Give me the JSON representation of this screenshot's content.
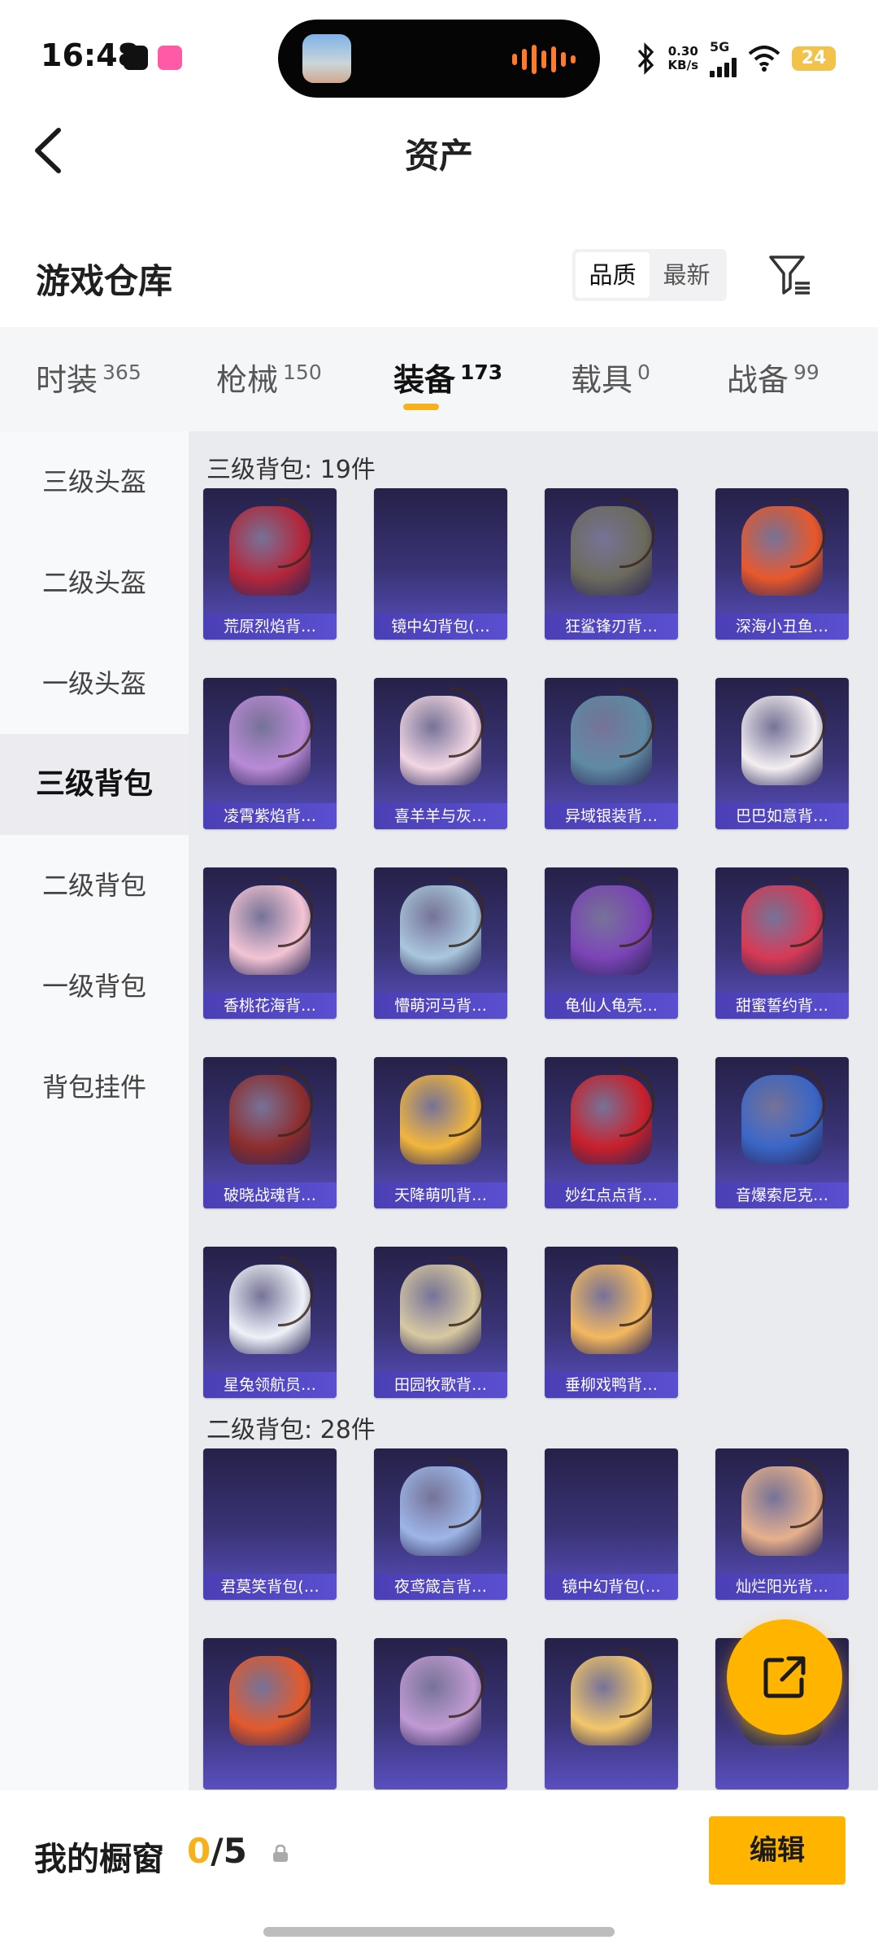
{
  "status": {
    "time": "16:48",
    "speed_value": "0.30",
    "speed_unit": "KB/s",
    "network": "5G",
    "battery": "24"
  },
  "header": {
    "title": "资产"
  },
  "section": {
    "title": "游戏仓库",
    "sort_options": [
      "品质",
      "最新"
    ]
  },
  "tabs": [
    {
      "label": "时装",
      "count": "365"
    },
    {
      "label": "枪械",
      "count": "150"
    },
    {
      "label": "装备",
      "count": "173"
    },
    {
      "label": "载具",
      "count": "0"
    },
    {
      "label": "战备",
      "count": "99"
    }
  ],
  "sidebar": {
    "items": [
      "三级头盔",
      "二级头盔",
      "一级头盔",
      "三级背包",
      "二级背包",
      "一级背包",
      "背包挂件"
    ],
    "active": "三级背包"
  },
  "groups": [
    {
      "title": "三级背包: 19件",
      "items": [
        {
          "label": "荒原烈焰背…",
          "art": "#b3263a"
        },
        {
          "label": "镜中幻背包(…",
          "art": ""
        },
        {
          "label": "狂鲨锋刃背…",
          "art": "#6c6a5c"
        },
        {
          "label": "深海小丑鱼…",
          "art": "#e8582b"
        },
        {
          "label": "凌霄紫焰背…",
          "art": "#b98ad6"
        },
        {
          "label": "喜羊羊与灰…",
          "art": "#f2d6e2"
        },
        {
          "label": "异域银装背…",
          "art": "#5f8aa3"
        },
        {
          "label": "巴巴如意背…",
          "art": "#f3eef0"
        },
        {
          "label": "香桃花海背…",
          "art": "#f3c4d4"
        },
        {
          "label": "懵萌河马背…",
          "art": "#a9c7dc"
        },
        {
          "label": "龟仙人龟壳…",
          "art": "#7b44b6"
        },
        {
          "label": "甜蜜誓约背…",
          "art": "#d63a55"
        },
        {
          "label": "破晓战魂背…",
          "art": "#8d2d2d"
        },
        {
          "label": "天降萌叽背…",
          "art": "#f2b63c"
        },
        {
          "label": "妙红点点背…",
          "art": "#c8202b"
        },
        {
          "label": "音爆索尼克…",
          "art": "#3a66c6"
        },
        {
          "label": "星兔领航员…",
          "art": "#eef2f8"
        },
        {
          "label": "田园牧歌背…",
          "art": "#d7c9a1"
        },
        {
          "label": "垂柳戏鸭背…",
          "art": "#f3b860"
        }
      ]
    },
    {
      "title": "二级背包: 28件",
      "items": [
        {
          "label": "君莫笑背包(…",
          "art": ""
        },
        {
          "label": "夜鸢箴言背…",
          "art": "#9db6e6"
        },
        {
          "label": "镜中幻背包(…",
          "art": ""
        },
        {
          "label": "灿烂阳光背…",
          "art": "#e6b08c"
        },
        {
          "label": "",
          "art": "#e25a2c"
        },
        {
          "label": "",
          "art": "#c09ad2"
        },
        {
          "label": "",
          "art": "#f2c66a"
        },
        {
          "label": "",
          "art": "#4a4a4a"
        }
      ]
    }
  ],
  "showcase": {
    "label": "我的橱窗",
    "current": "0",
    "total": "/5"
  },
  "edit_label": "编辑"
}
